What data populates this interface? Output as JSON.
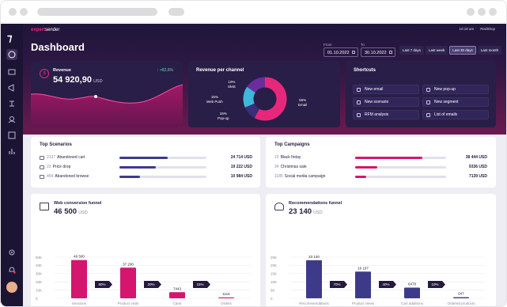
{
  "app": {
    "brand_prefix": "expert",
    "brand_suffix": "sender",
    "time": "10:18 am",
    "user": "RedShop",
    "page_title": "Dashboard"
  },
  "dates": {
    "from_label": "From",
    "from_value": "01.10.2022",
    "to_label": "To",
    "to_value": "30.10.2022",
    "ranges": [
      "Last 7 days",
      "Last week",
      "Last 30 days",
      "Last month"
    ],
    "active_range": "Last 30 days"
  },
  "revenue": {
    "label": "Revenue",
    "value": "54 920,90",
    "currency": "USD",
    "change": "+82,6%"
  },
  "channel": {
    "title": "Revenue per channel",
    "slices": [
      {
        "name": "Email",
        "percent": 55,
        "color": "#e8277b"
      },
      {
        "name": "SMS",
        "percent": 10,
        "color": "#3a2d7a"
      },
      {
        "name": "Web Push",
        "percent": 15,
        "color": "#3fb7d8"
      },
      {
        "name": "Pop-up",
        "percent": 15,
        "color": "#6a2d9e"
      }
    ],
    "labels": {
      "email": "Email",
      "email_pct": "55%",
      "sms": "SMS",
      "sms_pct": "10%",
      "webpush": "Web Push",
      "webpush_pct": "15%",
      "popup": "Pop-up",
      "popup_pct": "15%"
    }
  },
  "shortcuts": {
    "title": "Shortcuts",
    "items": [
      "New email",
      "New pop-up",
      "New scenario",
      "New segment",
      "RFM analysis",
      "List of emails"
    ]
  },
  "top_scenarios": {
    "title": "Top Scenarios",
    "rows": [
      {
        "count": "2137",
        "name": "Abandoned cart",
        "value": "24 714 USD",
        "fraction": 0.55
      },
      {
        "count": "23",
        "name": "Price drop",
        "value": "19 222 USD",
        "fraction": 0.42
      },
      {
        "count": "454",
        "name": "Abandoned browse",
        "value": "10 984 USD",
        "fraction": 0.24
      }
    ],
    "bar_color": "#3e3a8a"
  },
  "top_campaigns": {
    "title": "Top Campaigns",
    "rows": [
      {
        "count": "23",
        "name": "Black friday",
        "value": "38 444 USD",
        "fraction": 0.74
      },
      {
        "count": "34",
        "name": "Christmas sale",
        "value": "9336 USD",
        "fraction": 0.24
      },
      {
        "count": "1185",
        "name": "Social media campaign",
        "value": "7139 USD",
        "fraction": 0.12
      }
    ],
    "bar_color": "#d4166f"
  },
  "web_funnel": {
    "title": "Web conversion funnel",
    "value": "46 500",
    "currency": "USD",
    "color": "#d4166f",
    "y_ticks": [
      "50K",
      "40K",
      "30K",
      "20K",
      "10K",
      "0"
    ],
    "categories": [
      "Sessions",
      "Product visits",
      "Carts",
      "Orders"
    ],
    "values": [
      46500,
      37200,
      7443,
      1116
    ],
    "value_labels": [
      "46 500",
      "37 200",
      "7443",
      "1116"
    ],
    "conversions": [
      "80%",
      "20%",
      "15%"
    ]
  },
  "rec_funnel": {
    "title": "Recommendations funnel",
    "value": "23 140",
    "currency": "USD",
    "color": "#3e3a8a",
    "y_ticks": [
      "25K",
      "20K",
      "15K",
      "10K",
      "5K",
      "0"
    ],
    "categories": [
      "Recommendations",
      "Product views",
      "Cart additions",
      "Ordered products"
    ],
    "values": [
      23140,
      16197,
      6478,
      647
    ],
    "value_labels": [
      "23 140",
      "16 197",
      "6478",
      "647"
    ],
    "conversions": [
      "70%",
      "40%",
      "10%"
    ]
  },
  "chart_data": [
    {
      "type": "bar",
      "title": "Web conversion funnel",
      "categories": [
        "Sessions",
        "Product visits",
        "Carts",
        "Orders"
      ],
      "values": [
        46500,
        37200,
        7443,
        1116
      ],
      "ylim": [
        0,
        50000
      ]
    },
    {
      "type": "bar",
      "title": "Recommendations funnel",
      "categories": [
        "Recommendations",
        "Product views",
        "Cart additions",
        "Ordered products"
      ],
      "values": [
        23140,
        16197,
        6478,
        647
      ],
      "ylim": [
        0,
        25000
      ]
    },
    {
      "type": "pie",
      "title": "Revenue per channel",
      "categories": [
        "Email",
        "SMS",
        "Web Push",
        "Pop-up"
      ],
      "values": [
        55,
        10,
        15,
        15
      ]
    }
  ]
}
